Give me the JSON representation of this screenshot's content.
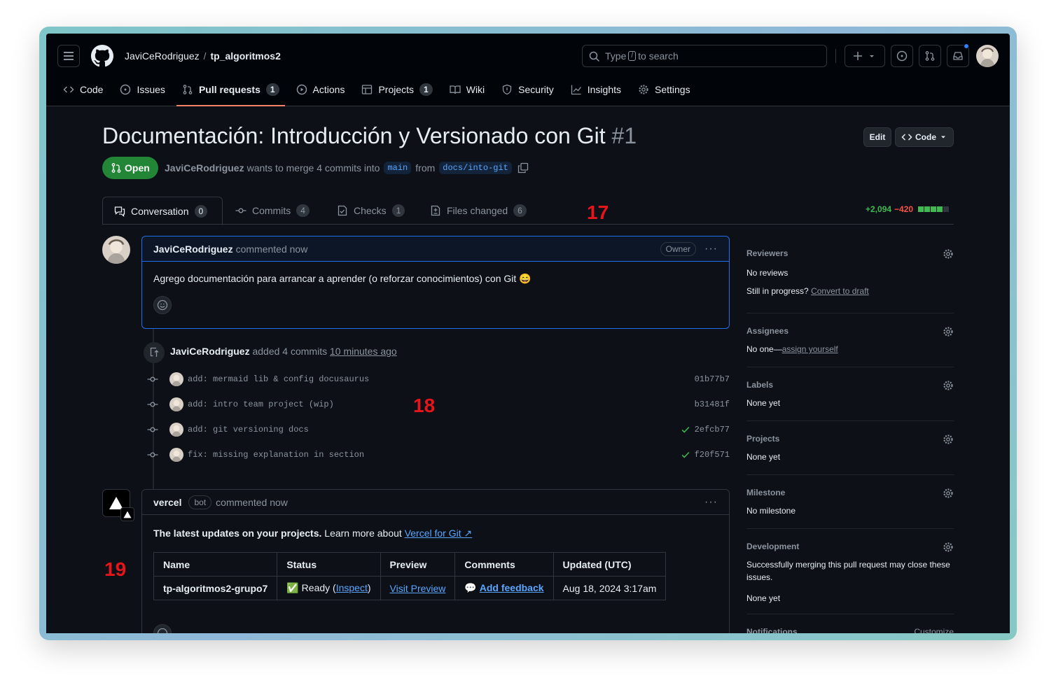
{
  "header": {
    "owner": "JaviCeRodriguez",
    "separator": "/",
    "repo": "tp_algoritmos2",
    "search": {
      "pre": "Type",
      "key": "/",
      "post": "to search"
    }
  },
  "repo_tabs": [
    {
      "label": "Code",
      "icon": "code-icon"
    },
    {
      "label": "Issues",
      "icon": "issue-icon"
    },
    {
      "label": "Pull requests",
      "icon": "pull-request-icon",
      "count": "1"
    },
    {
      "label": "Actions",
      "icon": "play-icon"
    },
    {
      "label": "Projects",
      "icon": "table-icon",
      "count": "1"
    },
    {
      "label": "Wiki",
      "icon": "book-icon"
    },
    {
      "label": "Security",
      "icon": "shield-icon"
    },
    {
      "label": "Insights",
      "icon": "graph-icon"
    },
    {
      "label": "Settings",
      "icon": "gear-icon"
    }
  ],
  "pr": {
    "title": "Documentación: Introducción y Versionado con Git",
    "number": "#1",
    "edit_label": "Edit",
    "code_label": "Code",
    "state": "Open",
    "author": "JaviCeRodriguez",
    "merge_text": "wants to merge 4 commits into",
    "base": "main",
    "from_text": "from",
    "head": "docs/into-git"
  },
  "pr_tabs": [
    {
      "label": "Conversation",
      "count": "0"
    },
    {
      "label": "Commits",
      "count": "4"
    },
    {
      "label": "Checks",
      "count": "1"
    },
    {
      "label": "Files changed",
      "count": "6"
    }
  ],
  "diffstat": {
    "additions": "+2,094",
    "deletions": "−420"
  },
  "annotations": {
    "a17": "17",
    "a18": "18",
    "a19": "19"
  },
  "comment1": {
    "author": "JaviCeRodriguez",
    "action": "commented now",
    "badge": "Owner",
    "body": "Agrego documentación para arrancar a aprender (o reforzar conocimientos) con Git 😄"
  },
  "commits_event": {
    "author": "JaviCeRodriguez",
    "action": "added 4 commits",
    "time": "10 minutes ago",
    "commits": [
      {
        "message": "add: mermaid lib & config docusaurus",
        "sha": "01b77b7",
        "check": false
      },
      {
        "message": "add: intro team project (wip)",
        "sha": "b31481f",
        "check": false
      },
      {
        "message": "add: git versioning docs",
        "sha": "2efcb77",
        "check": true
      },
      {
        "message": "fix: missing explanation in section",
        "sha": "f20f571",
        "check": true
      }
    ]
  },
  "comment2": {
    "author": "vercel",
    "badge": "bot",
    "action": "commented now",
    "intro_bold": "The latest updates on your projects.",
    "intro_rest": "Learn more about",
    "intro_link": "Vercel for Git ↗",
    "table": {
      "headers": [
        "Name",
        "Status",
        "Preview",
        "Comments",
        "Updated (UTC)"
      ],
      "row": {
        "name": "tp-algoritmos2-grupo7",
        "status_emoji": "✅",
        "status": "Ready",
        "status_link": "Inspect",
        "preview": "Visit Preview",
        "comments_emoji": "💬",
        "comments": "Add feedback",
        "updated": "Aug 18, 2024 3:17am"
      }
    }
  },
  "sidebar": {
    "reviewers": {
      "title": "Reviewers",
      "value": "No reviews",
      "progress_q": "Still in progress?",
      "progress_link": "Convert to draft"
    },
    "assignees": {
      "title": "Assignees",
      "value": "No one—",
      "link": "assign yourself"
    },
    "labels": {
      "title": "Labels",
      "value": "None yet"
    },
    "projects": {
      "title": "Projects",
      "value": "None yet"
    },
    "milestone": {
      "title": "Milestone",
      "value": "No milestone"
    },
    "development": {
      "title": "Development",
      "text": "Successfully merging this pull request may close these issues.",
      "value": "None yet"
    },
    "notifications": {
      "title": "Notifications",
      "action": "Customize"
    }
  },
  "colors": {
    "accent": "#f78166",
    "open": "#238636",
    "link": "#58a6ff",
    "add": "#3fb950",
    "del": "#f85149",
    "annotation": "#e5151b"
  }
}
